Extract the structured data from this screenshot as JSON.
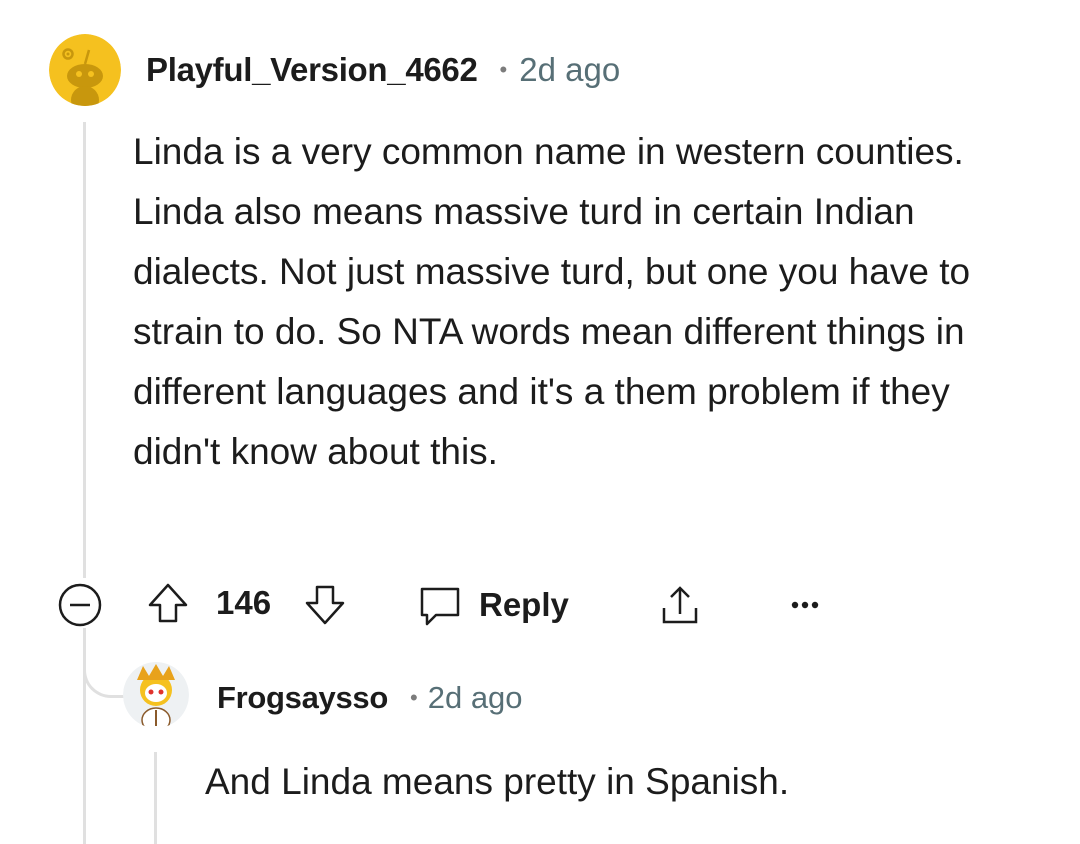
{
  "comment": {
    "username": "Playful_Version_4662",
    "separator": "•",
    "time": "2d ago",
    "avatar_icon": "snoo-avatar-yellow",
    "body": "Linda is a very common name in western counties. Linda also means massive turd in certain Indian dialects. Not just massive turd, but one you have to strain to do. So NTA words mean different things in different languages and it's a them problem if they didn't know about this.",
    "score": "146",
    "reply_label": "Reply",
    "icons": [
      "collapse-icon",
      "upvote-icon",
      "downvote-icon",
      "reply-icon",
      "share-icon",
      "more-icon"
    ]
  },
  "reply": {
    "username": "Frogsaysso",
    "separator": "•",
    "time": "2d ago",
    "avatar_icon": "snoo-avatar-costume",
    "body": "And Linda means pretty in Spanish."
  },
  "colors": {
    "avatar_yellow": "#f5c11f",
    "thread_line": "#e0e0e0",
    "meta_gray": "#576f76"
  }
}
